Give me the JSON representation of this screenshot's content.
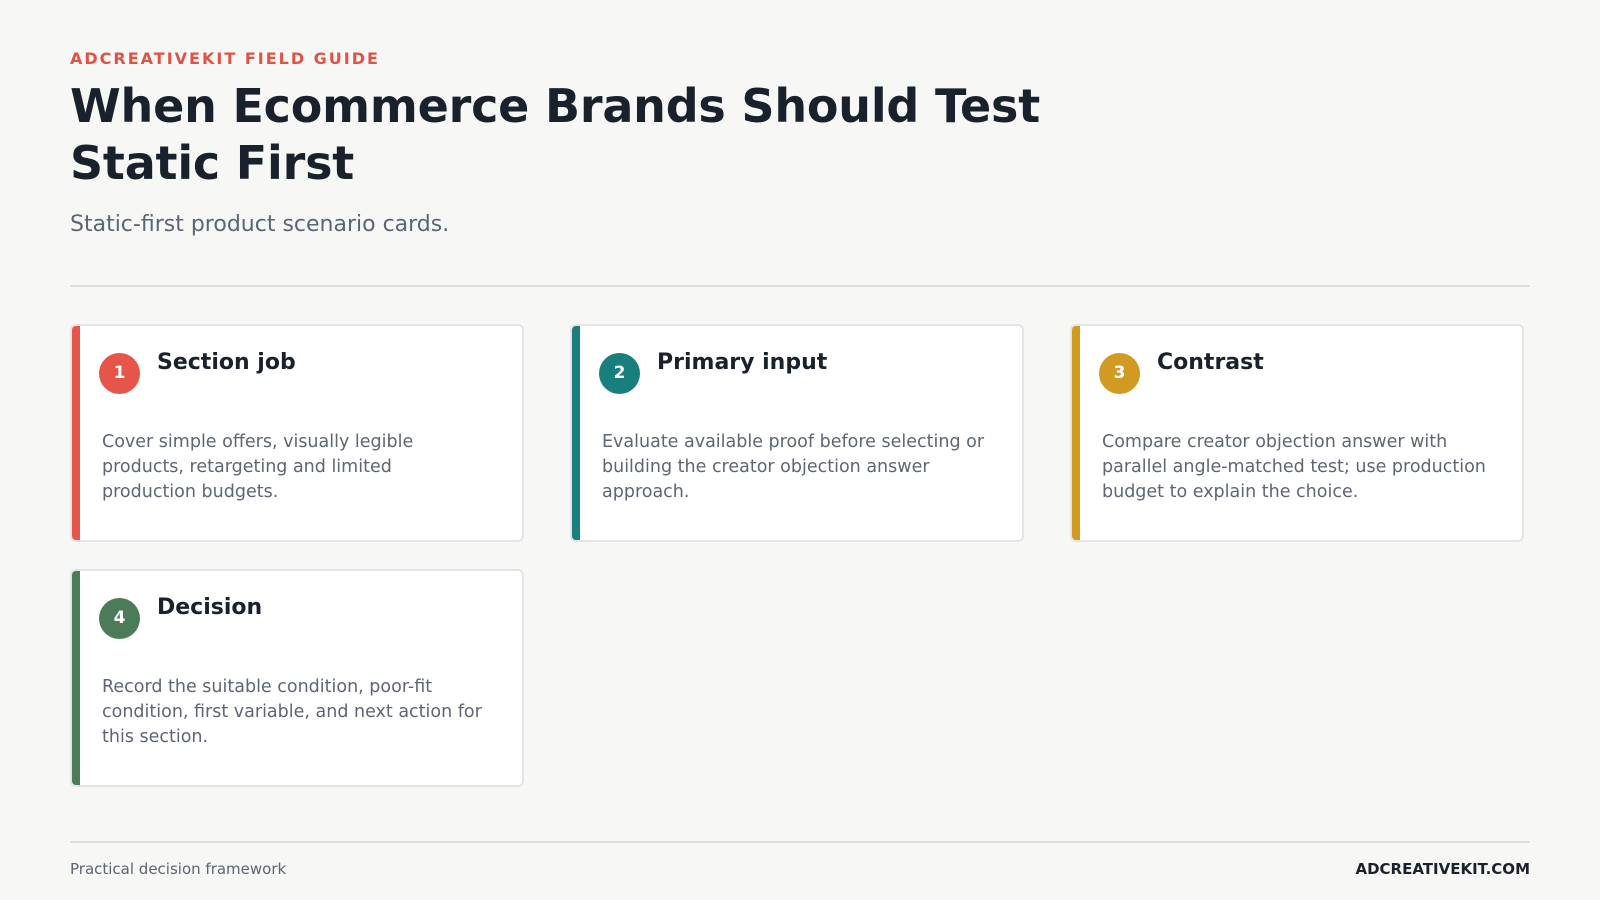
{
  "header": {
    "eyebrow": "ADCREATIVEKIT FIELD GUIDE",
    "title": "When Ecommerce Brands Should Test Static First",
    "subtitle": "Static-first product scenario cards."
  },
  "cards": [
    {
      "number": "1",
      "title": "Section job",
      "body": "Cover simple offers, visually legible products, retargeting and limited production budgets.",
      "accent": "#e5554a"
    },
    {
      "number": "2",
      "title": "Primary input",
      "body": "Evaluate available proof before selecting or building the creator objection answer approach.",
      "accent": "#187f7d"
    },
    {
      "number": "3",
      "title": "Contrast",
      "body": "Compare creator objection answer with parallel angle-matched test; use production budget to explain the choice.",
      "accent": "#d19a22"
    },
    {
      "number": "4",
      "title": "Decision",
      "body": "Record the suitable condition, poor-fit condition, first variable, and next action for this section.",
      "accent": "#4c7c57"
    }
  ],
  "footer": {
    "left": "Practical decision framework",
    "right": "ADCREATIVEKIT.COM"
  }
}
